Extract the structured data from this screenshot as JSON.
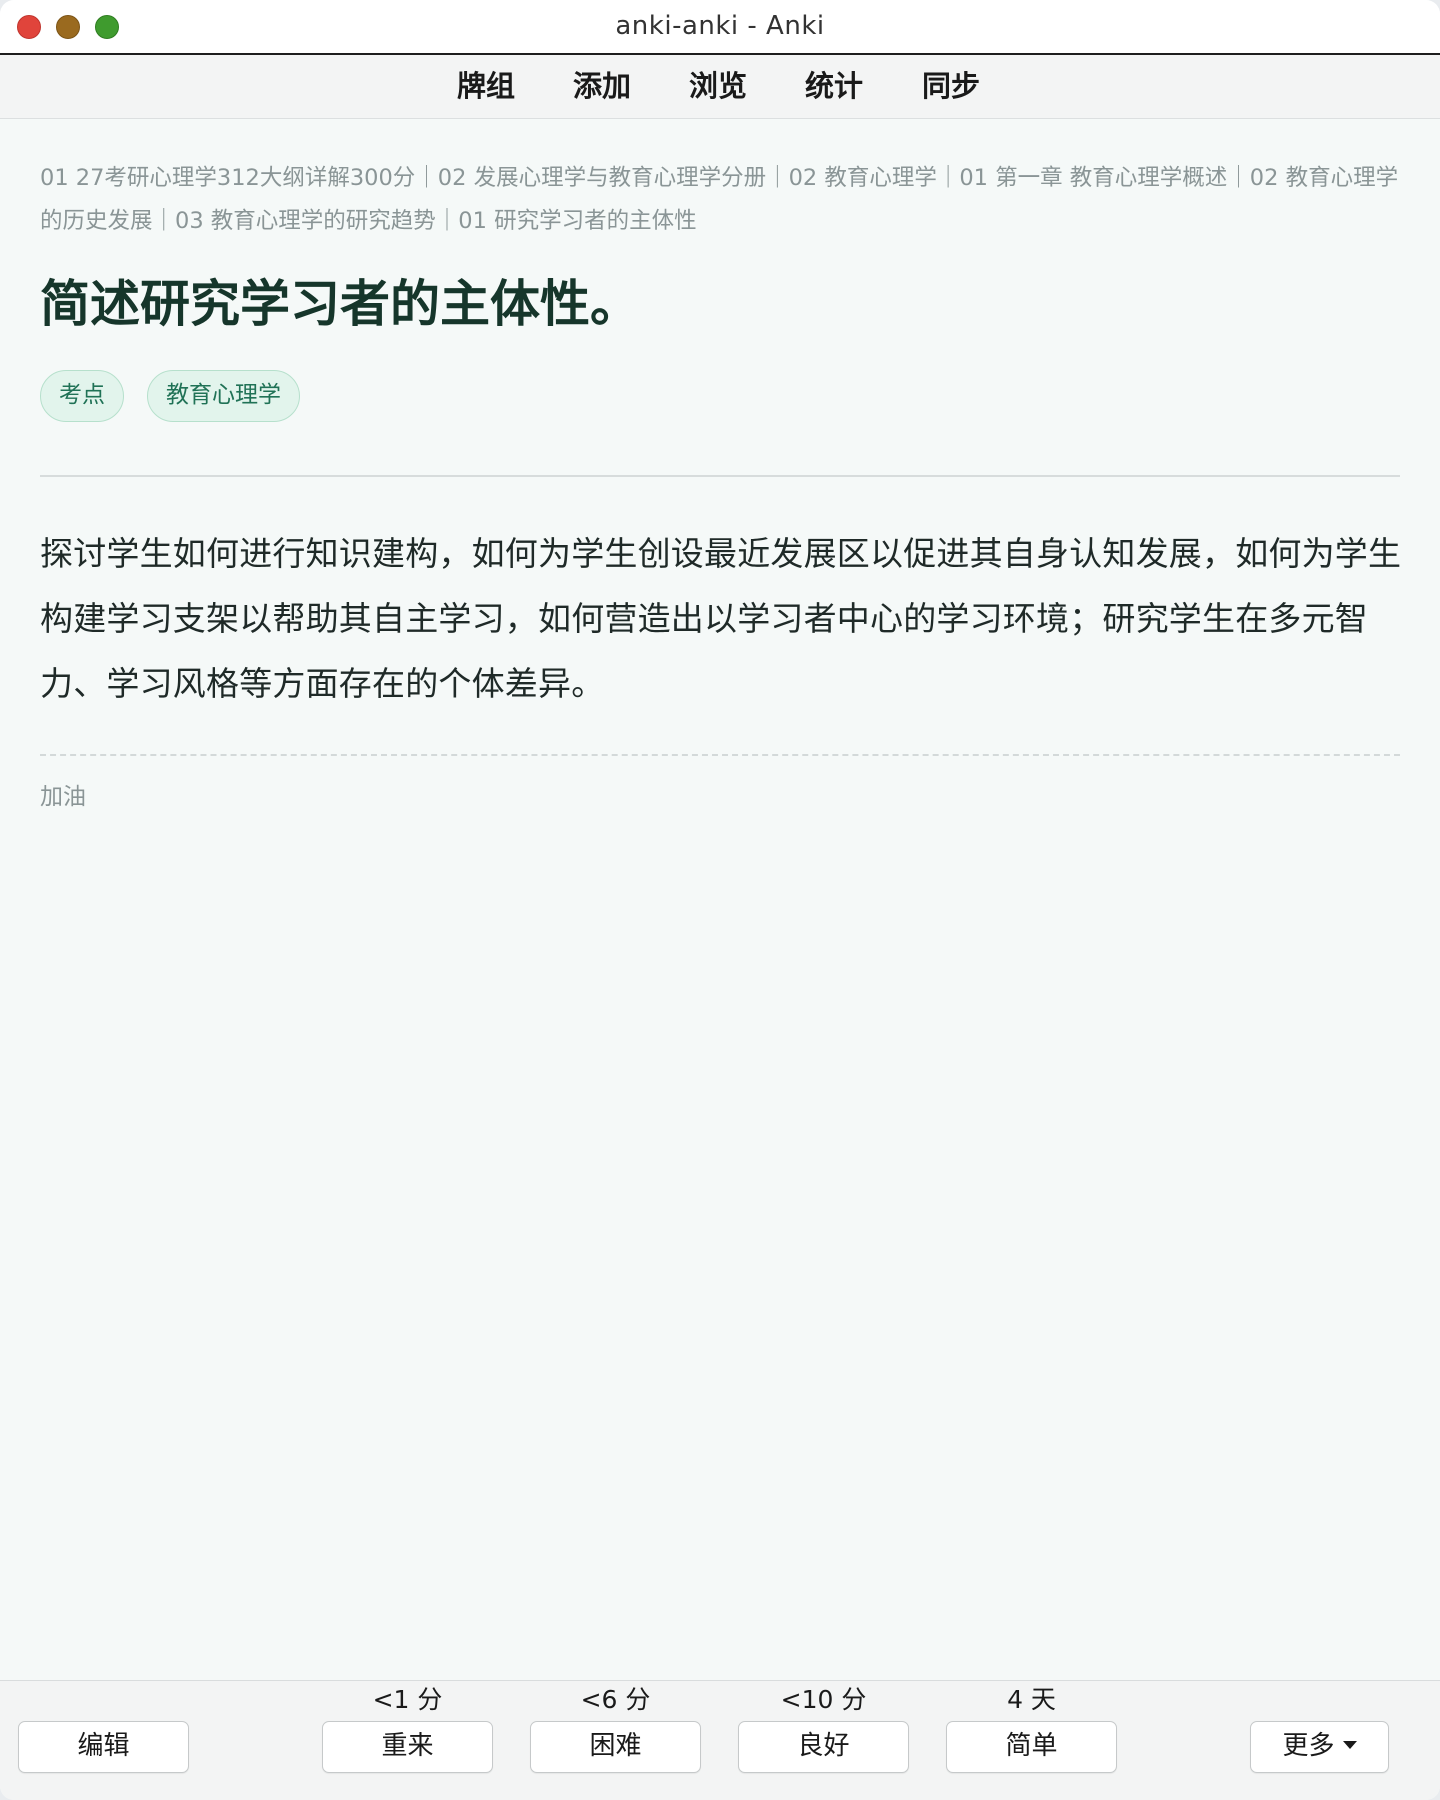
{
  "window": {
    "title": "anki-anki - Anki"
  },
  "menu": {
    "decks": "牌组",
    "add": "添加",
    "browse": "浏览",
    "stats": "统计",
    "sync": "同步"
  },
  "card": {
    "breadcrumb": "01 27考研心理学312大纲详解300分｜02 发展心理学与教育心理学分册｜02 教育心理学｜01 第一章 教育心理学概述｜02 教育心理学的历史发展｜03 教育心理学的研究趋势｜01 研究学习者的主体性",
    "question": "简述研究学习者的主体性。",
    "tags": [
      "考点",
      "教育心理学"
    ],
    "answer": "探讨学生如何进行知识建构，如何为学生创设最近发展区以促进其自身认知发展，如何为学生构建学习支架以帮助其自主学习，如何营造出以学习者中心的学习环境；研究学生在多元智力、学习风格等方面存在的个体差异。",
    "extra": "加油"
  },
  "review": {
    "edit_label": "编辑",
    "more_label": "更多",
    "answers": [
      {
        "label": "重来",
        "interval": "<1 分"
      },
      {
        "label": "困难",
        "interval": "<6 分"
      },
      {
        "label": "良好",
        "interval": "<10 分"
      },
      {
        "label": "简单",
        "interval": "4 天"
      }
    ]
  },
  "colors": {
    "question_text": "#16362b",
    "tag_background": "#e2f4ec",
    "tag_text": "#207256",
    "traffic_close": "#e0443b",
    "traffic_minimize": "#9a6a1f",
    "traffic_zoom": "#3f9b2e"
  }
}
